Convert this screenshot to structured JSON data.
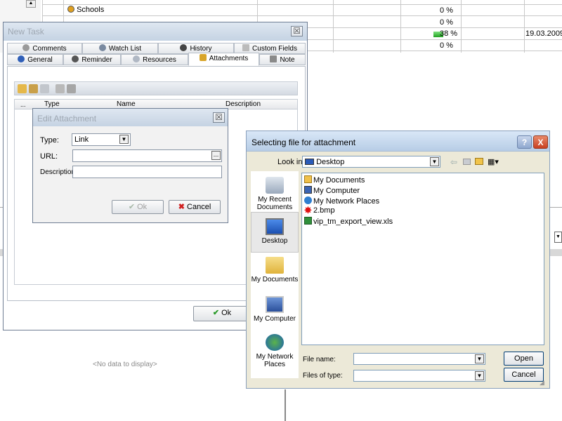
{
  "background_list": {
    "rows": [
      {
        "name": "Schools",
        "percent": "0 %",
        "date": ""
      },
      {
        "name": "",
        "percent": "0 %",
        "date": ""
      },
      {
        "name": "",
        "percent": "38 %",
        "progress": 0.38,
        "date": "19.03.2009"
      },
      {
        "name": "",
        "percent": "0 %",
        "date": ""
      }
    ],
    "empty_text": "<No data to display>"
  },
  "new_task": {
    "title": "New Task",
    "tabs_row1": [
      "Comments",
      "Watch List",
      "History",
      "Custom Fields"
    ],
    "tabs_row2": [
      "General",
      "Reminder",
      "Resources",
      "Attachments",
      "Note"
    ],
    "active_tab": "Attachments",
    "grid_headers": {
      "dots": "...",
      "type": "Type",
      "name": "Name",
      "description": "Description"
    },
    "ok_label": "Ok"
  },
  "edit_attachment": {
    "title": "Edit Attachment",
    "type_label": "Type:",
    "type_value": "Link",
    "url_label": "URL:",
    "url_value": "",
    "browse_label": "...",
    "description_label": "Description:",
    "description_value": "",
    "ok_label": "Ok",
    "cancel_label": "Cancel"
  },
  "file_dialog": {
    "title": "Selecting file for attachment",
    "help_label": "?",
    "close_label": "X",
    "look_in_label": "Look in:",
    "look_in_value": "Desktop",
    "places": [
      {
        "name": "My Recent Documents",
        "icon": "recent-documents-icon"
      },
      {
        "name": "Desktop",
        "icon": "desktop-icon"
      },
      {
        "name": "My Documents",
        "icon": "my-documents-icon"
      },
      {
        "name": "My Computer",
        "icon": "my-computer-icon"
      },
      {
        "name": "My Network Places",
        "icon": "network-places-icon"
      }
    ],
    "files": [
      {
        "name": "My Documents",
        "icon": "folder-icon"
      },
      {
        "name": "My Computer",
        "icon": "computer-icon"
      },
      {
        "name": "My Network Places",
        "icon": "network-icon"
      },
      {
        "name": "2.bmp",
        "icon": "bitmap-icon"
      },
      {
        "name": "vip_tm_export_view.xls",
        "icon": "excel-icon"
      }
    ],
    "file_name_label": "File name:",
    "file_name_value": "",
    "files_of_type_label": "Files of type:",
    "files_of_type_value": "",
    "open_label": "Open",
    "cancel_label": "Cancel"
  }
}
